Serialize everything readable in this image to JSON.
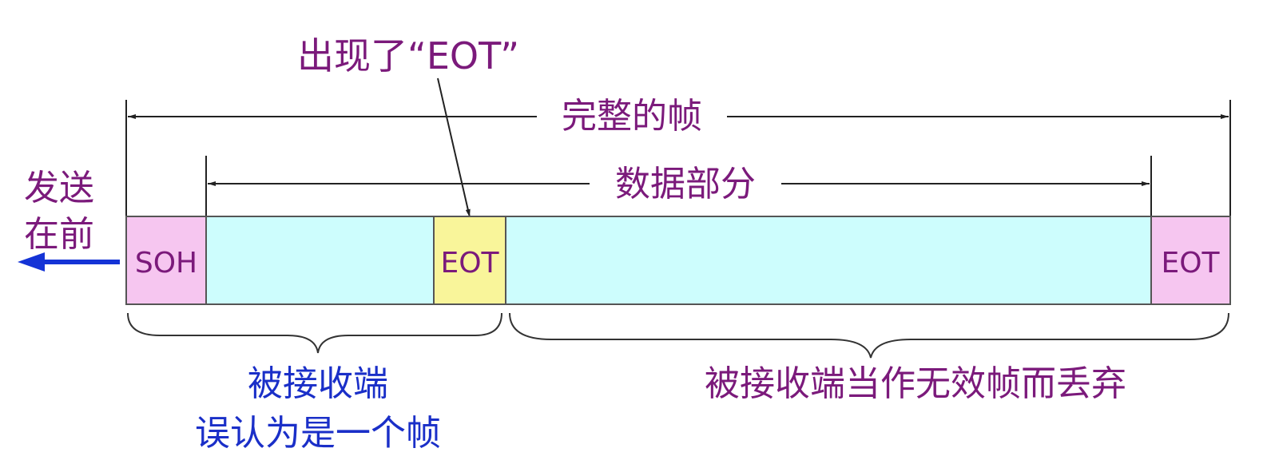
{
  "annotation_top": "出现了“EOT”",
  "frame_label": "完整的帧",
  "data_label": "数据部分",
  "send_first": [
    "发送",
    "在前"
  ],
  "segments": {
    "soh": "SOH",
    "eot_mid": "EOT",
    "eot_end": "EOT"
  },
  "brace_left_caption": [
    "被接收端",
    "误认为是一个帧"
  ],
  "brace_right_caption": "被接收端当作无效帧而丢弃",
  "colors": {
    "purple_text": "#7b1a7b",
    "blue_text": "#1a2fc8",
    "arrow_blue": "#1433d6",
    "soh_fill": "#f6c6f0",
    "data_fill": "#cdfdfd",
    "eot_mid_fill": "#f9f59a",
    "eot_end_fill": "#f6c6f0"
  }
}
